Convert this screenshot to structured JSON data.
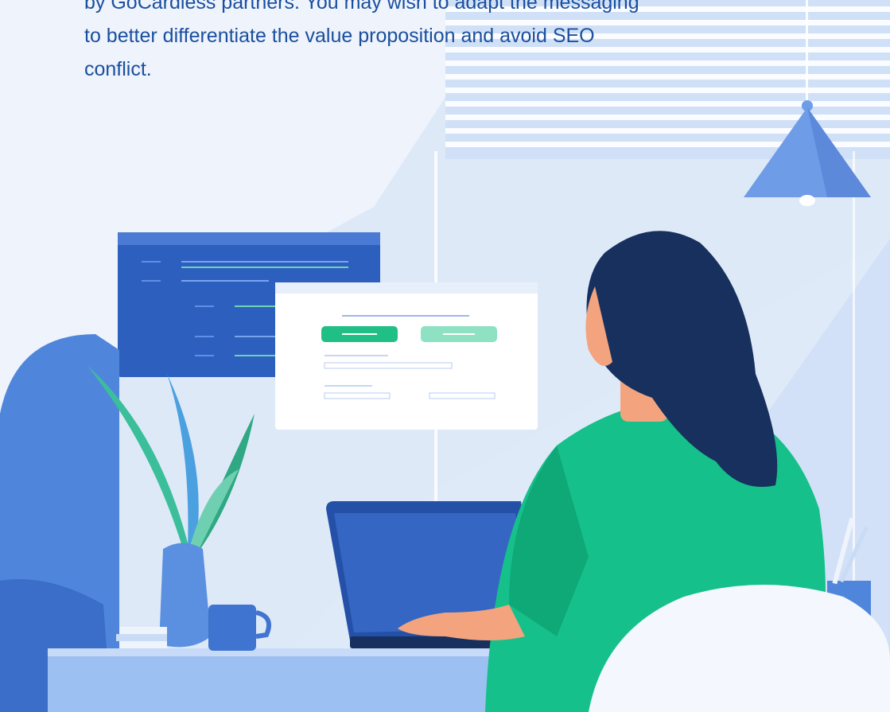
{
  "intro": {
    "lines": [
      "by GoCardless partners. You may wish to adapt the messaging",
      "to better differentiate the value proposition and avoid SEO",
      "conflict."
    ]
  },
  "colors": {
    "text": "#1a4f9e",
    "background": "#dfeaf9",
    "wall_light": "#eef3fc",
    "blue_mid": "#5b8fe0",
    "blue_dark": "#1f4fa0",
    "navy_hair": "#17305e",
    "green_sweater": "#16c08a",
    "skin": "#f3a47e",
    "plant_green": "#3bbf9a"
  }
}
